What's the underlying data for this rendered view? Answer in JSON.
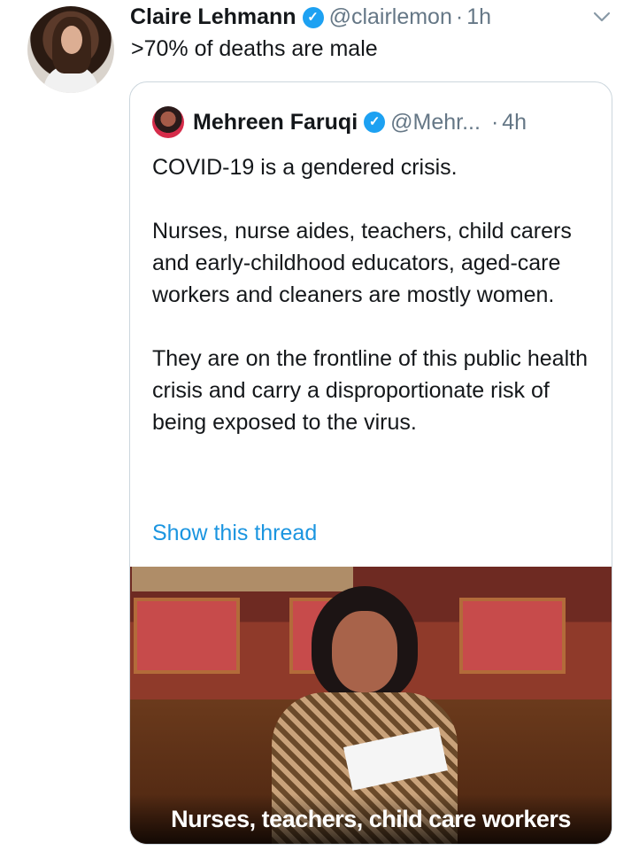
{
  "tweet": {
    "author_name": "Claire Lehmann",
    "handle": "@clairlemon",
    "separator": "·",
    "time": "1h",
    "text": ">70% of deaths are male"
  },
  "quote": {
    "author_name": "Mehreen Faruqi",
    "handle": "@Mehr...",
    "separator": "·",
    "time": "4h",
    "paragraphs": [
      "COVID-19 is a gendered crisis.",
      "Nurses, nurse aides, teachers, child carers and early-childhood educators, aged-care workers and cleaners are mostly women.",
      "They are on the frontline of this public health crisis and carry a disproportionate risk of being exposed to the virus."
    ],
    "show_thread": "Show this thread",
    "media_caption": "Nurses, teachers, child care workers"
  },
  "icons": {
    "verified": "verified-badge-icon",
    "menu": "chevron-down-icon"
  },
  "colors": {
    "link": "#1b95e0",
    "verified": "#1da1f2",
    "secondary_text": "#657786"
  }
}
